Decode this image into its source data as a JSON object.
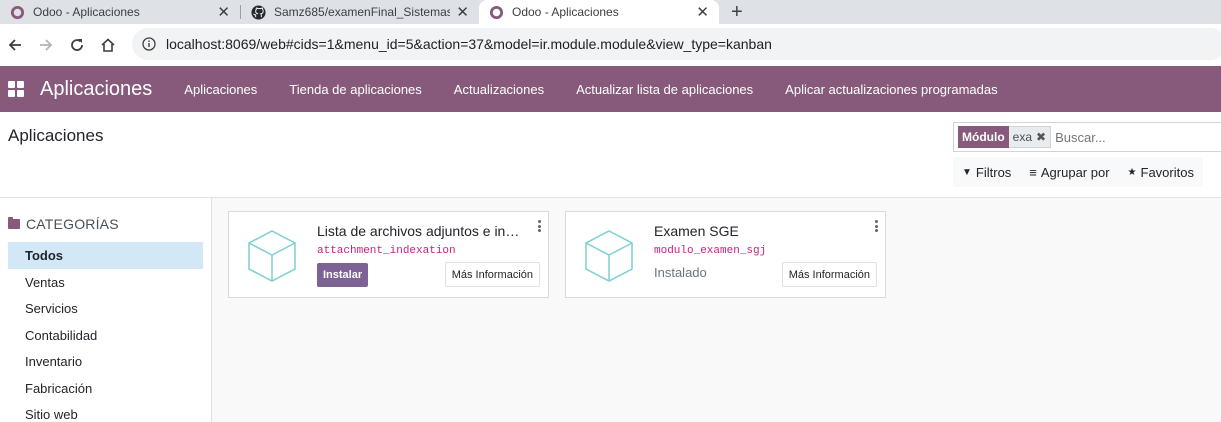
{
  "browser": {
    "tabs": [
      {
        "title": "Odoo - Aplicaciones",
        "icon": "odoo-icon",
        "active": false
      },
      {
        "title": "Samz685/examenFinal_Sistemas",
        "icon": "github-icon",
        "active": false
      },
      {
        "title": "Odoo - Aplicaciones",
        "icon": "odoo-icon",
        "active": true
      }
    ],
    "url": "localhost:8069/web#cids=1&menu_id=5&action=37&model=ir.module.module&view_type=kanban"
  },
  "navbar": {
    "brand": "Aplicaciones",
    "menu": [
      "Aplicaciones",
      "Tienda de aplicaciones",
      "Actualizaciones",
      "Actualizar lista de aplicaciones",
      "Aplicar actualizaciones programadas"
    ],
    "color": "#875a7b"
  },
  "control_panel": {
    "title": "Aplicaciones",
    "search": {
      "facet_label": "Módulo",
      "facet_value": "exa",
      "placeholder": "Buscar..."
    },
    "filters": {
      "filters_label": "Filtros",
      "group_label": "Agrupar por",
      "favorites_label": "Favoritos"
    }
  },
  "sidebar": {
    "heading": "CATEGORÍAS",
    "items": [
      "Todos",
      "Ventas",
      "Servicios",
      "Contabilidad",
      "Inventario",
      "Fabricación",
      "Sitio web"
    ],
    "active_index": 0
  },
  "modules": [
    {
      "name": "Lista de archivos adjuntos e indexación",
      "technical": "attachment_indexation",
      "action": "Instalar",
      "more": "Más Información"
    },
    {
      "name": "Examen SGE",
      "technical": "modulo_examen_sgj",
      "status": "Instalado",
      "more": "Más Información"
    }
  ]
}
